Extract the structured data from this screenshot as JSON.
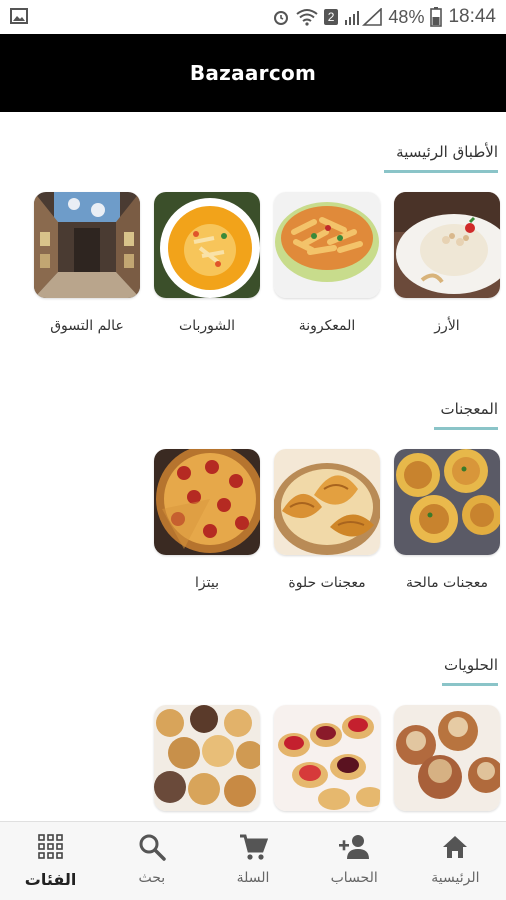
{
  "status_bar": {
    "battery": "48%",
    "time": "18:44",
    "sim_badge": "2",
    "icons": [
      "image-icon",
      "alarm-icon",
      "wifi-icon",
      "signal-icon",
      "battery-icon"
    ]
  },
  "app": {
    "title": "Bazaarcom",
    "accent_color": "#8ac4c8",
    "appbar_color": "#000000"
  },
  "sections": [
    {
      "title": "الأطباق الرئيسية",
      "items": [
        {
          "label": "الأرز",
          "image": "rice-image"
        },
        {
          "label": "المعكرونة",
          "image": "pasta-image"
        },
        {
          "label": "الشوربات",
          "image": "soup-image"
        },
        {
          "label": "عالم التسوق",
          "image": "mall-image"
        }
      ]
    },
    {
      "title": "المعجنات",
      "items": [
        {
          "label": "معجنات مالحة",
          "image": "savory-pastry-image"
        },
        {
          "label": "معجنات حلوة",
          "image": "croissant-image"
        },
        {
          "label": "بيتزا",
          "image": "pizza-image"
        }
      ]
    },
    {
      "title": "الحلويات",
      "items": [
        {
          "label": "",
          "image": "nut-pastry-image"
        },
        {
          "label": "",
          "image": "tart-image"
        },
        {
          "label": "",
          "image": "cupcake-image"
        }
      ]
    }
  ],
  "bottom_nav": [
    {
      "label": "الرئيسية",
      "icon": "home-icon",
      "active": false
    },
    {
      "label": "الحساب",
      "icon": "add-person-icon",
      "active": false
    },
    {
      "label": "السلة",
      "icon": "cart-icon",
      "active": false
    },
    {
      "label": "بحث",
      "icon": "search-icon",
      "active": false
    },
    {
      "label": "الفئات",
      "icon": "grid-icon",
      "active": true
    }
  ]
}
